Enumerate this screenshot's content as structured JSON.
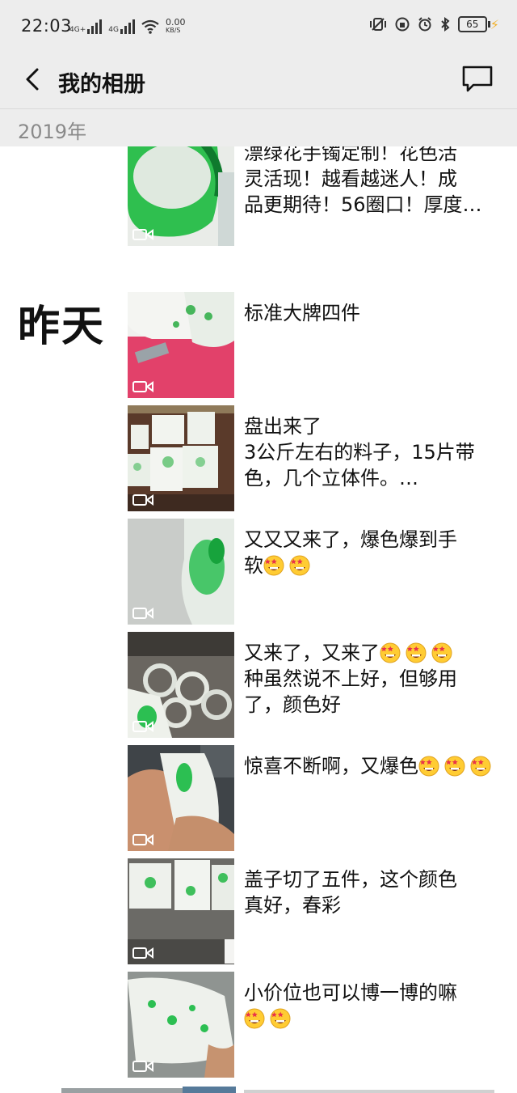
{
  "status_bar": {
    "time": "22:03",
    "net1": "4G+",
    "net2": "4G",
    "speed_value": "0.00",
    "speed_unit": "KB/S",
    "battery": "65"
  },
  "header": {
    "title": "我的相册"
  },
  "year_label": "2019年",
  "day_label": "昨天",
  "posts": [
    {
      "caption": "漂绿花手镯定制！花色活\n灵活现！越看越迷人！成\n品更期待！56圈口！厚度…",
      "emojis": 0,
      "media": "video"
    },
    {
      "caption": "标准大牌四件",
      "emojis": 0,
      "media": "video"
    },
    {
      "caption": "盘出来了\n3公斤左右的料子，15片带\n色，几个立体件。…",
      "emojis": 0,
      "media": "video"
    },
    {
      "caption": "又又又来了，爆色爆到手\n软",
      "emojis": 2,
      "media": "video"
    },
    {
      "caption": "又来了，又来了",
      "caption2": "种虽然说不上好，但够用\n了，颜色好",
      "emojis": 3,
      "media": "video"
    },
    {
      "caption": "惊喜不断啊，又爆色",
      "emojis": 3,
      "media": "video"
    },
    {
      "caption": "盖子切了五件，这个颜色\n真好，春彩",
      "emojis": 0,
      "media": "video"
    },
    {
      "caption": "小价位也可以博一博的嘛",
      "emojis": 2,
      "media": "video"
    }
  ],
  "icons": {
    "back": "chevron-left-icon",
    "messages": "message-bubble-icon",
    "video": "video-camera-icon",
    "emoji": "star-struck-emoji"
  },
  "colors": {
    "bar_bg": "#ededed",
    "jade_green": "#2fbf4f",
    "year_text": "#8a8a8a"
  }
}
